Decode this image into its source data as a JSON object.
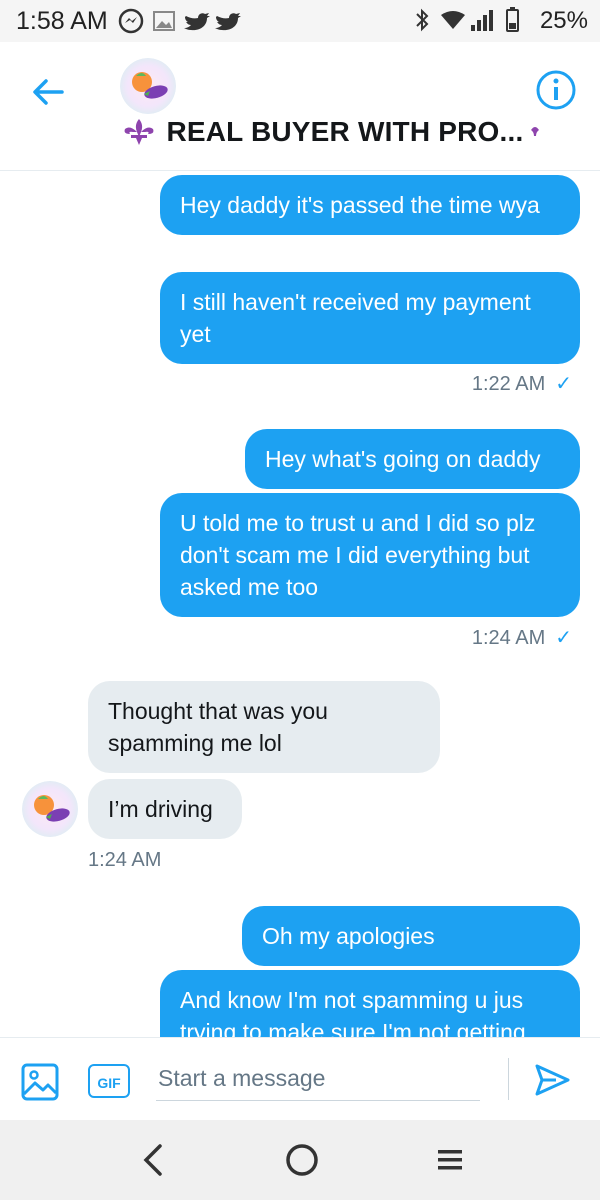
{
  "status_bar": {
    "time": "1:58 AM",
    "battery": "25%"
  },
  "header": {
    "title": "REAL BUYER WITH PRO..."
  },
  "messages": [
    {
      "text": "Hey daddy it's passed the time wya"
    },
    {
      "text": "I still haven't received my payment yet"
    },
    {
      "text": "1:22 AM"
    },
    {
      "text": "Hey what's going on daddy"
    },
    {
      "text": "U told me to trust u and I did so plz don't scam me I did everything but asked me too"
    },
    {
      "text": "1:24 AM"
    },
    {
      "text": "Thought that was you spamming me lol"
    },
    {
      "text": "I’m driving"
    },
    {
      "text": "1:24 AM"
    },
    {
      "text": "Oh my apologies"
    },
    {
      "text": "And know I'm not spamming u jus trying to make sure I'm not getting"
    }
  ],
  "composer": {
    "gif_label": "GIF",
    "placeholder": "Start a message"
  },
  "colors": {
    "accent": "#1da1f2",
    "incoming_bubble": "#e6ecf0"
  },
  "icons": [
    "messenger-icon",
    "gallery-icon",
    "twitter-icon",
    "bluetooth-icon",
    "wifi-icon",
    "signal-icon",
    "battery-icon",
    "back-arrow-icon",
    "info-icon",
    "fleur-de-lis-icon",
    "image-icon",
    "send-icon"
  ]
}
